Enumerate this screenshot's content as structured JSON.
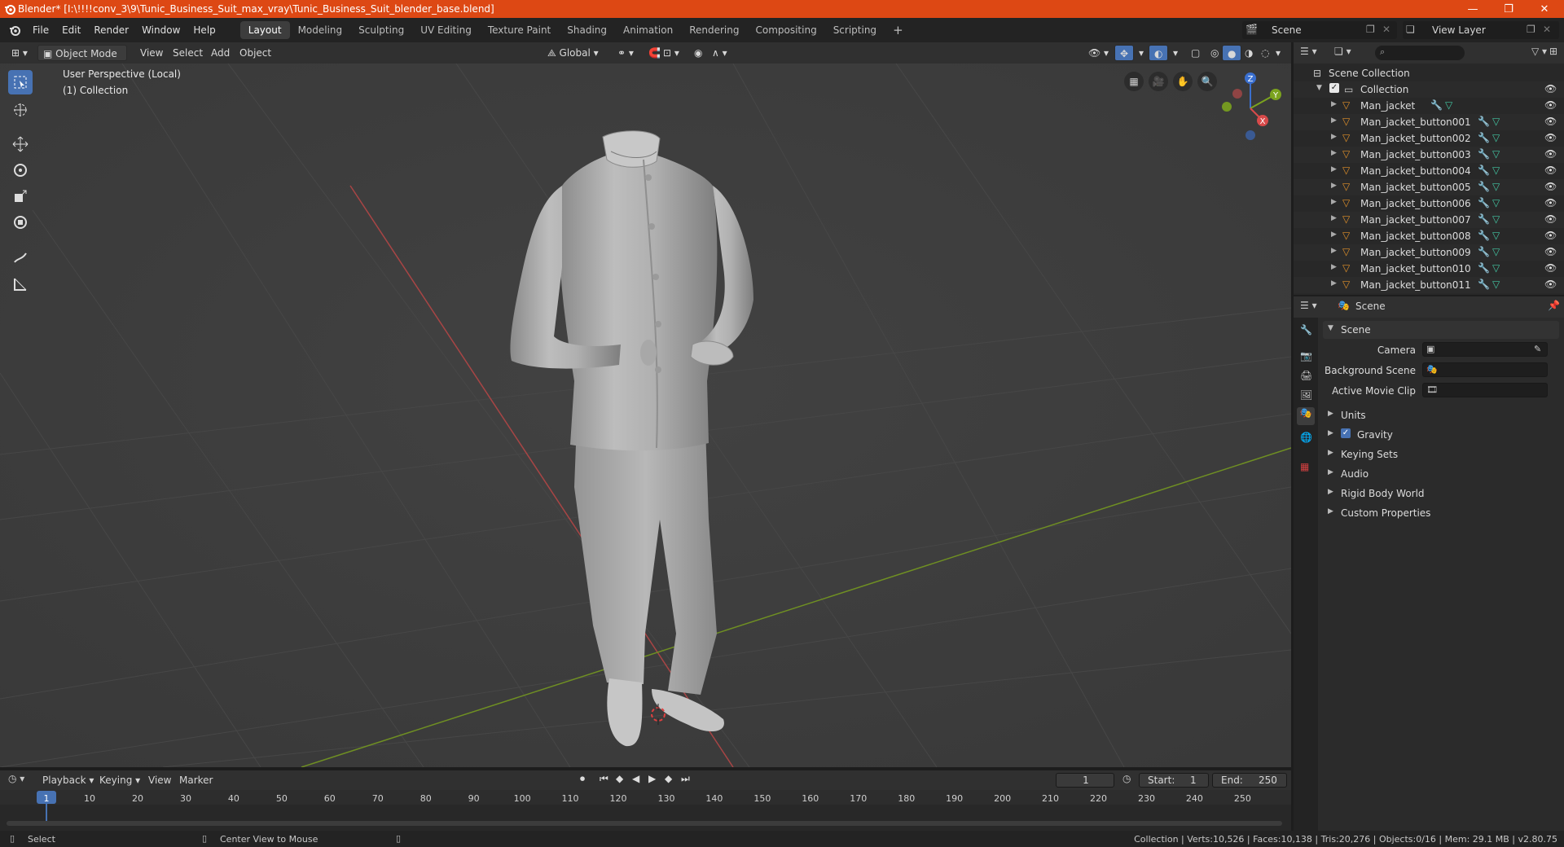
{
  "window": {
    "title": "Blender* [I:\\!!!!conv_3\\9\\Tunic_Business_Suit_max_vray\\Tunic_Business_Suit_blender_base.blend]",
    "minimize": "—",
    "maximize": "❐",
    "close": "✕"
  },
  "menu": [
    "File",
    "Edit",
    "Render",
    "Window",
    "Help"
  ],
  "workspaces": [
    "Layout",
    "Modeling",
    "Sculpting",
    "UV Editing",
    "Texture Paint",
    "Shading",
    "Animation",
    "Rendering",
    "Compositing",
    "Scripting"
  ],
  "active_workspace": "Layout",
  "add_workspace": "+",
  "scene_selector": "Scene",
  "view_layer": "View Layer",
  "viewport_header": {
    "mode": "Object Mode",
    "view": "View",
    "select": "Select",
    "add": "Add",
    "object": "Object",
    "orientation": "Global"
  },
  "viewport_overlay": {
    "perspective": "User Perspective (Local)",
    "collection": "(1) Collection"
  },
  "gizmo_axes": {
    "z": "Z",
    "y": "Y",
    "x": "X"
  },
  "outliner": {
    "root": "Scene Collection",
    "collection": "Collection",
    "items": [
      "Man_jacket",
      "Man_jacket_button001",
      "Man_jacket_button002",
      "Man_jacket_button003",
      "Man_jacket_button004",
      "Man_jacket_button005",
      "Man_jacket_button006",
      "Man_jacket_button007",
      "Man_jacket_button008",
      "Man_jacket_button009",
      "Man_jacket_button010",
      "Man_jacket_button011"
    ]
  },
  "properties": {
    "context": "Scene",
    "panel_title": "Scene",
    "camera_label": "Camera",
    "background_scene_label": "Background Scene",
    "active_movie_clip_label": "Active Movie Clip",
    "sections": [
      "Units",
      "Gravity",
      "Keying Sets",
      "Audio",
      "Rigid Body World",
      "Custom Properties"
    ],
    "gravity_checked": true
  },
  "timeline": {
    "playback": "Playback",
    "keying": "Keying",
    "view": "View",
    "marker": "Marker",
    "current_frame": "1",
    "start_label": "Start:",
    "start": "1",
    "end_label": "End:",
    "end": "250",
    "ticks": [
      "1",
      "10",
      "20",
      "30",
      "40",
      "50",
      "60",
      "70",
      "80",
      "90",
      "100",
      "110",
      "120",
      "130",
      "140",
      "150",
      "160",
      "170",
      "180",
      "190",
      "200",
      "210",
      "220",
      "230",
      "240",
      "250"
    ]
  },
  "status": {
    "left": "Select",
    "middle": "Center View to Mouse",
    "right": "Collection | Verts:10,526 | Faces:10,138 | Tris:20,276 | Objects:0/16 | Mem: 29.1 MB | v2.80.75"
  },
  "colors": {
    "title_bar": "#dd4814",
    "accent_blue": "#4772b3",
    "x_axis": "#c84b4b",
    "y_axis": "#7ba31e",
    "object_orange": "#e0902a",
    "mesh_green": "#43c7a3"
  }
}
